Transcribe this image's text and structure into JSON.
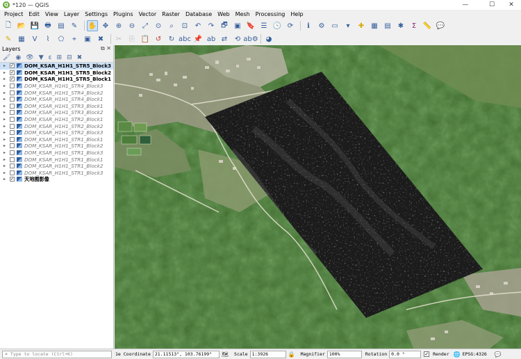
{
  "window": {
    "title": "*120 — QGIS",
    "minimize": "—",
    "maximize": "☐",
    "close": "✕"
  },
  "menu": [
    "Project",
    "Edit",
    "View",
    "Layer",
    "Settings",
    "Plugins",
    "Vector",
    "Raster",
    "Database",
    "Web",
    "Mesh",
    "Processing",
    "Help"
  ],
  "layers_panel": {
    "title": "Layers",
    "float_btn": "⧉",
    "close_btn": "✕",
    "items": [
      {
        "name": "DOM_KSAR_H1H1_STR5_Block3",
        "checked": true,
        "visible": true
      },
      {
        "name": "DOM_KSAR_H1H1_STR5_Block2",
        "checked": true,
        "visible": true
      },
      {
        "name": "DOM_KSAR_H1H1_STR5_Block1",
        "checked": true,
        "visible": true
      },
      {
        "name": "DOM_KSAR_H1H1_STR4_Block3",
        "checked": false,
        "visible": false
      },
      {
        "name": "DOM_KSAR_H1H1_STR4_Block2",
        "checked": false,
        "visible": false
      },
      {
        "name": "DOM_KSAR_H1H1_STR4_Block1",
        "checked": false,
        "visible": false
      },
      {
        "name": "DOM_KSAR_H1H1_STR3_Block1",
        "checked": false,
        "visible": false
      },
      {
        "name": "DOM_KSAR_H1H1_STR3_Block2",
        "checked": false,
        "visible": false
      },
      {
        "name": "DOM_KSAR_H1H1_STR2_Block1",
        "checked": false,
        "visible": false
      },
      {
        "name": "DOM_KSAR_H1H1_STR2_Block2",
        "checked": false,
        "visible": false
      },
      {
        "name": "DOM_KSAR_H1H1_STR2_Block3",
        "checked": false,
        "visible": false
      },
      {
        "name": "DOM_KSAR_H1H1_STR1_Block1",
        "checked": false,
        "visible": false
      },
      {
        "name": "DOM_KSAR_H1H1_STR1_Block2",
        "checked": false,
        "visible": false
      },
      {
        "name": "DOM_KSAR_H1H1_STR1_Block3",
        "checked": false,
        "visible": false
      },
      {
        "name": "DOM_KSAR_H1H1_STR1_Block1",
        "checked": false,
        "visible": false
      },
      {
        "name": "DOM_KSAR_H1H1_STR1_Block2",
        "checked": false,
        "visible": false
      },
      {
        "name": "DOM_KSAR_H1H1_STR1_Block3",
        "checked": false,
        "visible": false
      },
      {
        "name": "天地图影像",
        "checked": true,
        "visible": true
      }
    ]
  },
  "status": {
    "locate_placeholder": "Type to locate (Ctrl+K)",
    "coord_label": "1e Coordinate",
    "coord_value": "21.11513°, 103.76199°",
    "scale_label": "Scale",
    "scale_value": "1:3926",
    "magnifier_label": "Magnifier",
    "magnifier_value": "100%",
    "rotation_label": "Rotation",
    "rotation_value": "0.0 °",
    "render_label": "Render",
    "crs_label": "EPSG:4326"
  },
  "colors": {
    "forest": "#3f6a2c",
    "sar_overlay": "#1c1c1c",
    "accent": "#355e9b"
  }
}
